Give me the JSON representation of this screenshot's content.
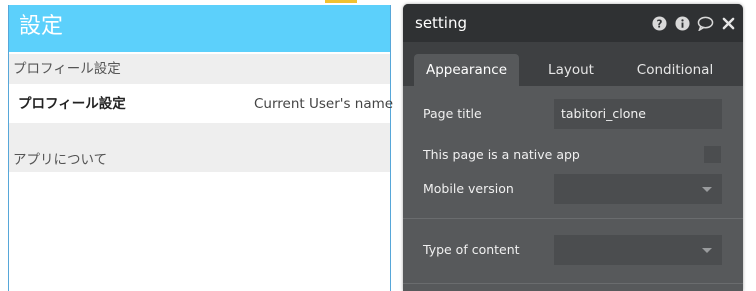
{
  "canvas": {
    "header_title": "設定",
    "section_profile_label": "プロフィール設定",
    "profile_row": {
      "title": "プロフィール設定",
      "value": "Current User's name"
    },
    "section_about_label": "アプリについて"
  },
  "editor": {
    "title": "setting",
    "icons": [
      "question-icon",
      "info-icon",
      "comment-icon",
      "close-icon"
    ],
    "tabs": [
      {
        "label": "Appearance",
        "active": true
      },
      {
        "label": "Layout",
        "active": false
      },
      {
        "label": "Conditional",
        "active": false
      }
    ],
    "page_title": {
      "label": "Page title",
      "value": "tabitori_clone"
    },
    "native_app": {
      "label": "This page is a native app",
      "checked": false
    },
    "mobile_version": {
      "label": "Mobile version",
      "value": ""
    },
    "type_of_content": {
      "label": "Type of content",
      "value": ""
    }
  },
  "colors": {
    "header_bg": "#5cd0fb",
    "canvas_border": "#57a7d9",
    "panel_bg": "#57595b",
    "panel_head_bg": "#2f3133"
  }
}
